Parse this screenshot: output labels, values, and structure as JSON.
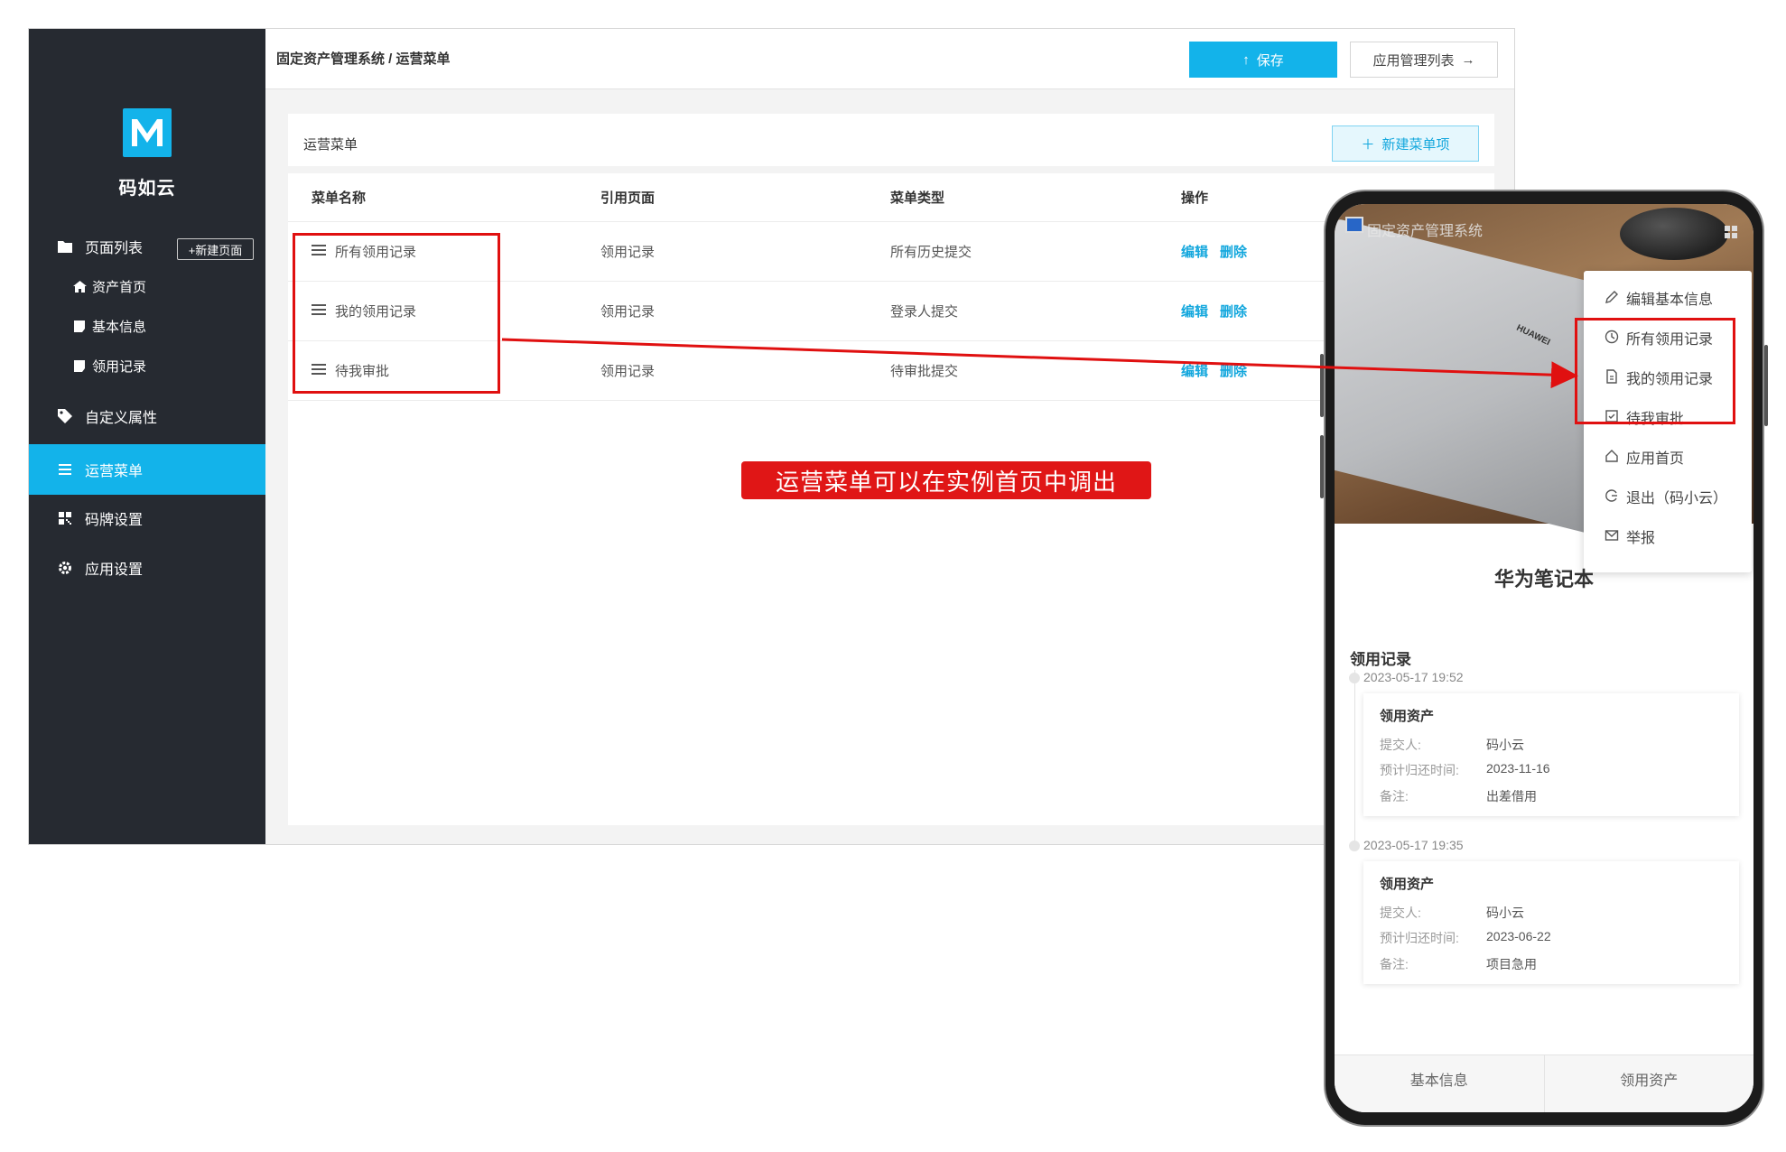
{
  "sidebar": {
    "brand": "码如云",
    "page_list": "页面列表",
    "new_page": "+新建页面",
    "pages": [
      "资产首页",
      "基本信息",
      "领用记录"
    ],
    "custom_props": "自定义属性",
    "ops_menu": "运营菜单",
    "code_settings": "码牌设置",
    "app_settings": "应用设置"
  },
  "header": {
    "breadcrumb": "固定资产管理系统 / 运营菜单",
    "save": "保存",
    "app_list": "应用管理列表"
  },
  "panel": {
    "title": "运营菜单",
    "new_menu": "新建菜单项",
    "columns": [
      "菜单名称",
      "引用页面",
      "菜单类型",
      "操作"
    ],
    "rows": [
      {
        "name": "所有领用记录",
        "page": "领用记录",
        "type": "所有历史提交",
        "edit": "编辑",
        "delete": "删除"
      },
      {
        "name": "我的领用记录",
        "page": "领用记录",
        "type": "登录人提交",
        "edit": "编辑",
        "delete": "删除"
      },
      {
        "name": "待我审批",
        "page": "领用记录",
        "type": "待审批提交",
        "edit": "编辑",
        "delete": "删除"
      }
    ]
  },
  "callout": "运营菜单可以在实例首页中调出",
  "phone": {
    "hero_title": "固定资产管理系统",
    "laptop_brand": "HUAWEI",
    "menu": [
      "编辑基本信息",
      "所有领用记录",
      "我的领用记录",
      "待我审批",
      "应用首页",
      "退出（码小云）",
      "举报"
    ],
    "asset_name": "华为笔记本",
    "section": "领用记录",
    "records": [
      {
        "time": "2023-05-17 19:52",
        "title": "领用资产",
        "submitter_k": "提交人:",
        "submitter": "码小云",
        "return_k": "预计归还时间:",
        "return": "2023-11-16",
        "note_k": "备注:",
        "note": "出差借用"
      },
      {
        "time": "2023-05-17 19:35",
        "title": "领用资产",
        "submitter_k": "提交人:",
        "submitter": "码小云",
        "return_k": "预计归还时间:",
        "return": "2023-06-22",
        "note_k": "备注:",
        "note": "项目急用"
      }
    ],
    "tabs": [
      "基本信息",
      "领用资产"
    ]
  },
  "colors": {
    "accent": "#13b3ea",
    "sidebar": "#262a31",
    "annotation": "#e01010"
  }
}
